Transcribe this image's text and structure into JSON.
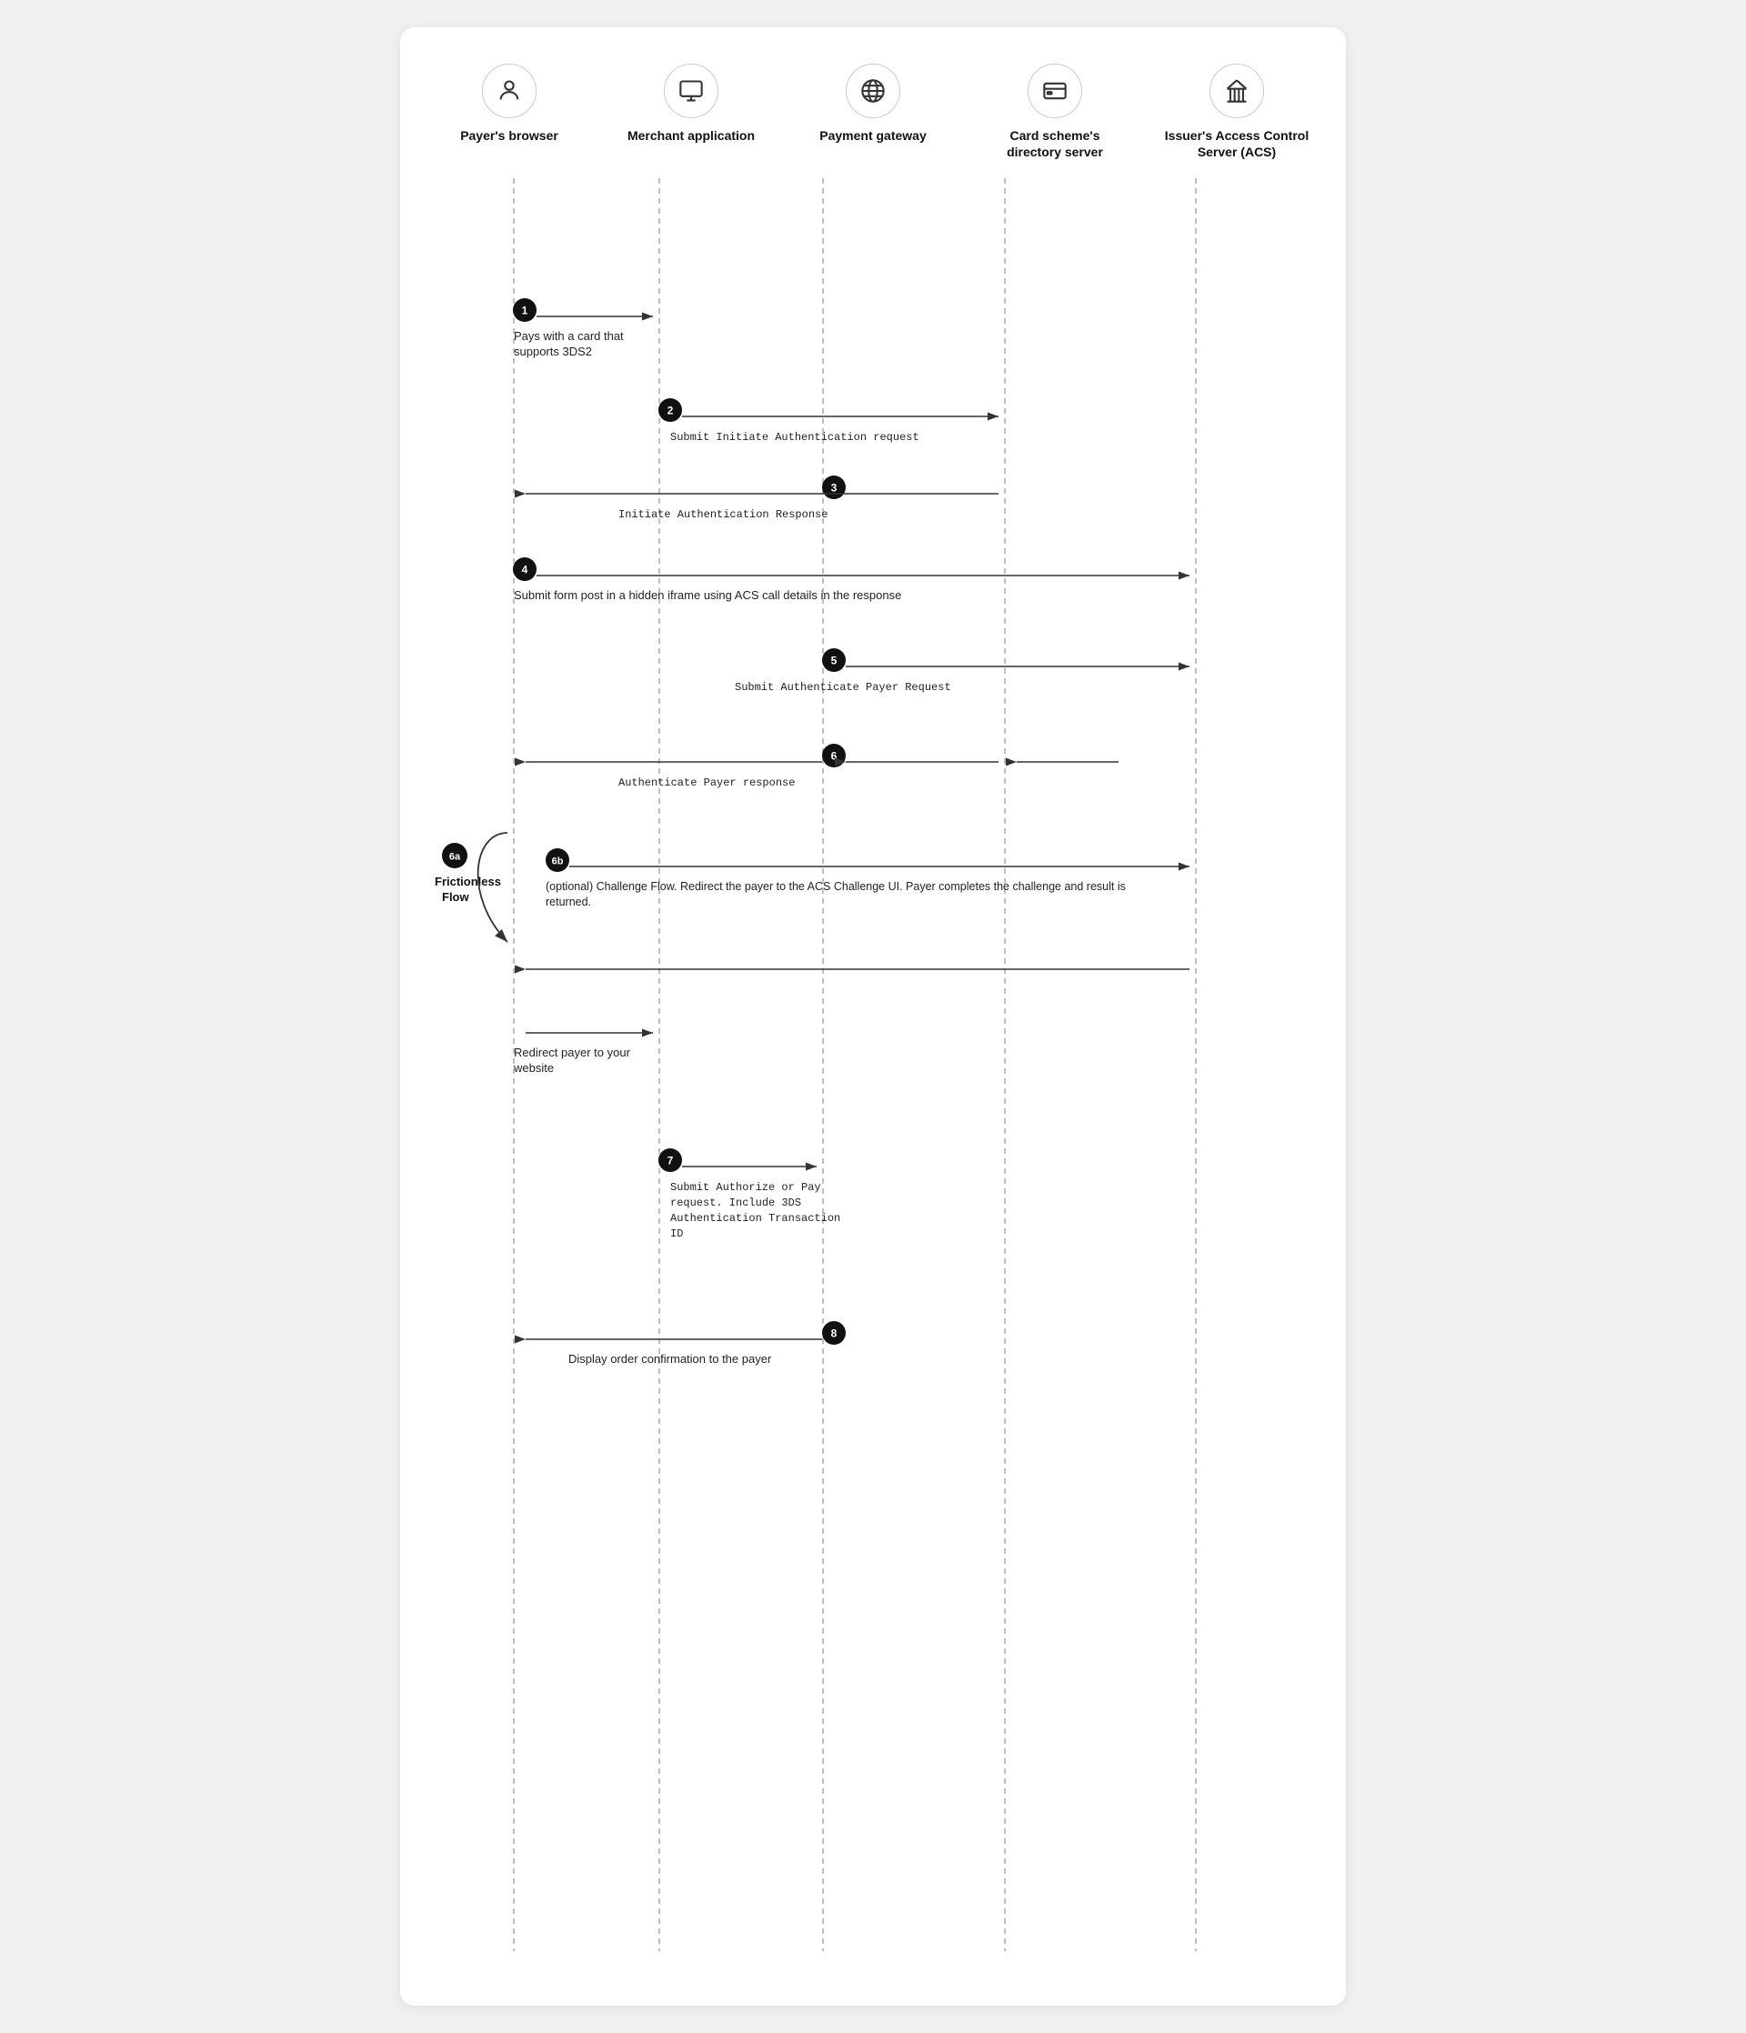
{
  "actors": [
    {
      "id": "browser",
      "label": "Payer's browser",
      "icon": "person"
    },
    {
      "id": "merchant",
      "label": "Merchant application",
      "icon": "monitor"
    },
    {
      "id": "gateway",
      "label": "Payment gateway",
      "icon": "globe"
    },
    {
      "id": "directory",
      "label": "Card scheme's directory server",
      "icon": "card"
    },
    {
      "id": "acs",
      "label": "Issuer's Access Control Server (ACS)",
      "icon": "bank"
    }
  ],
  "steps": [
    {
      "id": "1",
      "label": "Pays with a card that supports 3DS2",
      "from": "browser",
      "to": "merchant",
      "direction": "right",
      "labelType": "plain"
    },
    {
      "id": "2",
      "label": "Submit Initiate Authentication request",
      "from": "merchant",
      "to": "directory",
      "direction": "right",
      "labelType": "mono"
    },
    {
      "id": "3",
      "label": "Initiate Authentication Response",
      "from": "gateway",
      "to": "browser",
      "direction": "left",
      "labelType": "mono"
    },
    {
      "id": "4",
      "label": "Submit form post in a hidden iframe using ACS call details in the response",
      "from": "browser",
      "to": "acs",
      "direction": "right",
      "labelType": "plain"
    },
    {
      "id": "5",
      "label": "Submit Authenticate Payer Request",
      "from": "gateway",
      "to": "acs",
      "direction": "right",
      "labelType": "mono"
    },
    {
      "id": "6",
      "label": "Authenticate Payer response",
      "from": "acs",
      "to": "browser",
      "direction": "left",
      "labelType": "mono",
      "extra_arrow_from": "directory"
    },
    {
      "id": "6b",
      "label": "(optional) Challenge Flow. Redirect the payer to the ACS Challenge UI. Payer completes the challenge and result is returned.",
      "from": "merchant",
      "to": "acs",
      "direction": "right",
      "labelType": "plain"
    },
    {
      "id": "return",
      "label": "",
      "from": "acs",
      "to": "browser",
      "direction": "left",
      "noLabel": true
    },
    {
      "id": "redirect",
      "label": "Redirect payer to your website",
      "from": "browser",
      "to": "merchant",
      "direction": "right",
      "labelType": "plain"
    },
    {
      "id": "7",
      "label": "Submit Authorize or Pay request. Include 3DS Authentication Transaction ID",
      "from": "merchant",
      "to": "gateway",
      "direction": "right",
      "labelType": "mono_mixed"
    },
    {
      "id": "8",
      "label": "Display order confirmation to the payer",
      "from": "gateway",
      "to": "browser",
      "direction": "left",
      "labelType": "plain"
    }
  ],
  "frictionless": {
    "badge": "6a",
    "label": "Frictionless\nFlow"
  }
}
